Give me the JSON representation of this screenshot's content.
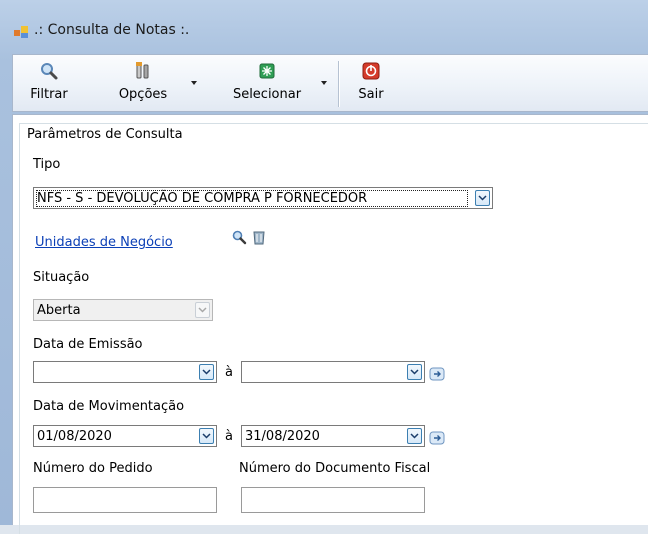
{
  "window": {
    "title": ".: Consulta de Notas :."
  },
  "toolbar": {
    "filtrar": "Filtrar",
    "opcoes": "Opções",
    "selecionar": "Selecionar",
    "sair": "Sair"
  },
  "group": {
    "title": "Parâmetros de Consulta"
  },
  "tipo": {
    "label": "Tipo",
    "value": "NFS - S - DEVOLUÇÃO DE COMPRA P FORNECEDOR"
  },
  "unidades": {
    "label": "Unidades de Negócio"
  },
  "situacao": {
    "label": "Situação",
    "value": "Aberta"
  },
  "emissao": {
    "label": "Data de Emissão",
    "from": "",
    "separator": "à",
    "to": ""
  },
  "movimentacao": {
    "label": "Data de Movimentação",
    "from": "01/08/2020",
    "separator": "à",
    "to": "31/08/2020"
  },
  "pedido": {
    "label": "Número do Pedido",
    "value": ""
  },
  "documento": {
    "label": "Número do Documento Fiscal",
    "value": ""
  },
  "icons": {
    "app": "window-app-icon",
    "filtrar": "magnifier-icon",
    "opcoes": "tools-icon",
    "selecionar": "select-icon",
    "sair": "exit-icon",
    "lookup": "magnifier-icon",
    "clear": "eraser-icon",
    "date_clear": "date-clear-icon"
  },
  "colors": {
    "link": "#0b3fb6",
    "accent": "#3c7fb1",
    "exit": "#d43b2b",
    "select": "#2f9e55"
  }
}
